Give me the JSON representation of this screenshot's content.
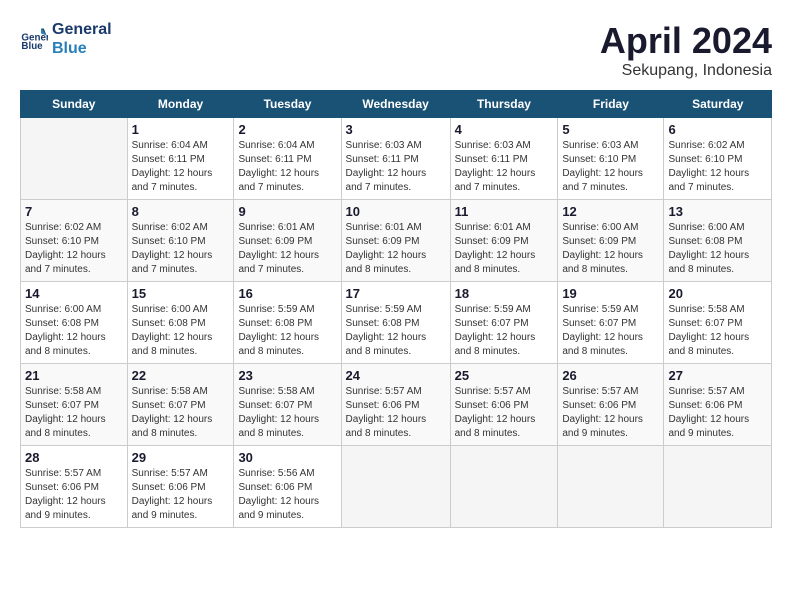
{
  "header": {
    "logo_line1": "General",
    "logo_line2": "Blue",
    "month": "April 2024",
    "location": "Sekupang, Indonesia"
  },
  "days_of_week": [
    "Sunday",
    "Monday",
    "Tuesday",
    "Wednesday",
    "Thursday",
    "Friday",
    "Saturday"
  ],
  "weeks": [
    [
      {
        "num": "",
        "info": ""
      },
      {
        "num": "1",
        "info": "Sunrise: 6:04 AM\nSunset: 6:11 PM\nDaylight: 12 hours\nand 7 minutes."
      },
      {
        "num": "2",
        "info": "Sunrise: 6:04 AM\nSunset: 6:11 PM\nDaylight: 12 hours\nand 7 minutes."
      },
      {
        "num": "3",
        "info": "Sunrise: 6:03 AM\nSunset: 6:11 PM\nDaylight: 12 hours\nand 7 minutes."
      },
      {
        "num": "4",
        "info": "Sunrise: 6:03 AM\nSunset: 6:11 PM\nDaylight: 12 hours\nand 7 minutes."
      },
      {
        "num": "5",
        "info": "Sunrise: 6:03 AM\nSunset: 6:10 PM\nDaylight: 12 hours\nand 7 minutes."
      },
      {
        "num": "6",
        "info": "Sunrise: 6:02 AM\nSunset: 6:10 PM\nDaylight: 12 hours\nand 7 minutes."
      }
    ],
    [
      {
        "num": "7",
        "info": "Sunrise: 6:02 AM\nSunset: 6:10 PM\nDaylight: 12 hours\nand 7 minutes."
      },
      {
        "num": "8",
        "info": "Sunrise: 6:02 AM\nSunset: 6:10 PM\nDaylight: 12 hours\nand 7 minutes."
      },
      {
        "num": "9",
        "info": "Sunrise: 6:01 AM\nSunset: 6:09 PM\nDaylight: 12 hours\nand 7 minutes."
      },
      {
        "num": "10",
        "info": "Sunrise: 6:01 AM\nSunset: 6:09 PM\nDaylight: 12 hours\nand 8 minutes."
      },
      {
        "num": "11",
        "info": "Sunrise: 6:01 AM\nSunset: 6:09 PM\nDaylight: 12 hours\nand 8 minutes."
      },
      {
        "num": "12",
        "info": "Sunrise: 6:00 AM\nSunset: 6:09 PM\nDaylight: 12 hours\nand 8 minutes."
      },
      {
        "num": "13",
        "info": "Sunrise: 6:00 AM\nSunset: 6:08 PM\nDaylight: 12 hours\nand 8 minutes."
      }
    ],
    [
      {
        "num": "14",
        "info": "Sunrise: 6:00 AM\nSunset: 6:08 PM\nDaylight: 12 hours\nand 8 minutes."
      },
      {
        "num": "15",
        "info": "Sunrise: 6:00 AM\nSunset: 6:08 PM\nDaylight: 12 hours\nand 8 minutes."
      },
      {
        "num": "16",
        "info": "Sunrise: 5:59 AM\nSunset: 6:08 PM\nDaylight: 12 hours\nand 8 minutes."
      },
      {
        "num": "17",
        "info": "Sunrise: 5:59 AM\nSunset: 6:08 PM\nDaylight: 12 hours\nand 8 minutes."
      },
      {
        "num": "18",
        "info": "Sunrise: 5:59 AM\nSunset: 6:07 PM\nDaylight: 12 hours\nand 8 minutes."
      },
      {
        "num": "19",
        "info": "Sunrise: 5:59 AM\nSunset: 6:07 PM\nDaylight: 12 hours\nand 8 minutes."
      },
      {
        "num": "20",
        "info": "Sunrise: 5:58 AM\nSunset: 6:07 PM\nDaylight: 12 hours\nand 8 minutes."
      }
    ],
    [
      {
        "num": "21",
        "info": "Sunrise: 5:58 AM\nSunset: 6:07 PM\nDaylight: 12 hours\nand 8 minutes."
      },
      {
        "num": "22",
        "info": "Sunrise: 5:58 AM\nSunset: 6:07 PM\nDaylight: 12 hours\nand 8 minutes."
      },
      {
        "num": "23",
        "info": "Sunrise: 5:58 AM\nSunset: 6:07 PM\nDaylight: 12 hours\nand 8 minutes."
      },
      {
        "num": "24",
        "info": "Sunrise: 5:57 AM\nSunset: 6:06 PM\nDaylight: 12 hours\nand 8 minutes."
      },
      {
        "num": "25",
        "info": "Sunrise: 5:57 AM\nSunset: 6:06 PM\nDaylight: 12 hours\nand 8 minutes."
      },
      {
        "num": "26",
        "info": "Sunrise: 5:57 AM\nSunset: 6:06 PM\nDaylight: 12 hours\nand 9 minutes."
      },
      {
        "num": "27",
        "info": "Sunrise: 5:57 AM\nSunset: 6:06 PM\nDaylight: 12 hours\nand 9 minutes."
      }
    ],
    [
      {
        "num": "28",
        "info": "Sunrise: 5:57 AM\nSunset: 6:06 PM\nDaylight: 12 hours\nand 9 minutes."
      },
      {
        "num": "29",
        "info": "Sunrise: 5:57 AM\nSunset: 6:06 PM\nDaylight: 12 hours\nand 9 minutes."
      },
      {
        "num": "30",
        "info": "Sunrise: 5:56 AM\nSunset: 6:06 PM\nDaylight: 12 hours\nand 9 minutes."
      },
      {
        "num": "",
        "info": ""
      },
      {
        "num": "",
        "info": ""
      },
      {
        "num": "",
        "info": ""
      },
      {
        "num": "",
        "info": ""
      }
    ]
  ]
}
